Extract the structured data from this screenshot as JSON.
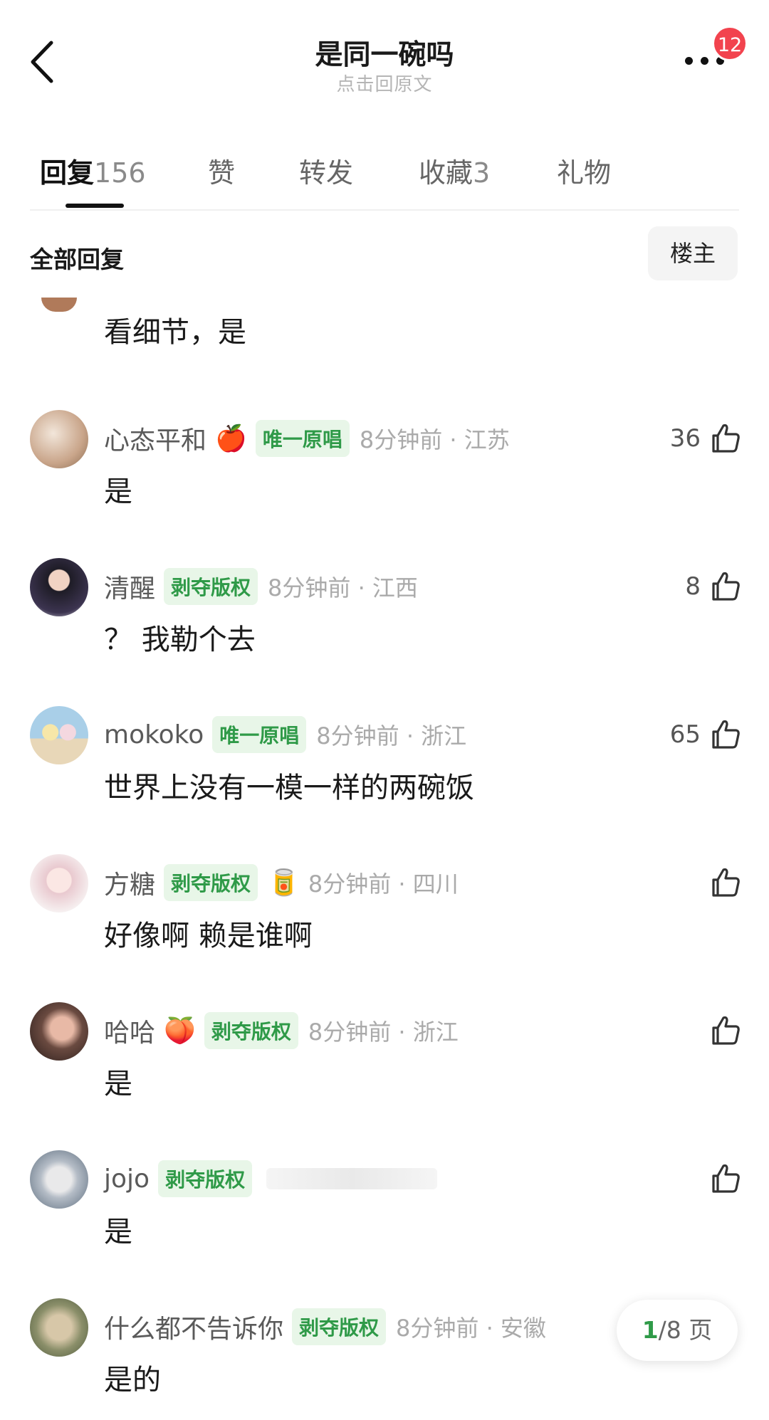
{
  "header": {
    "title": "是同一碗吗",
    "subtitle": "点击回原文",
    "badge_count": "12"
  },
  "tabs": [
    {
      "label": "回复",
      "count": "156",
      "active": true
    },
    {
      "label": "赞",
      "count": ""
    },
    {
      "label": "转发",
      "count": ""
    },
    {
      "label": "收藏",
      "count": "3"
    },
    {
      "label": "礼物",
      "count": ""
    }
  ],
  "section": {
    "title": "全部回复",
    "owner_button": "楼主"
  },
  "partial_comment": {
    "text": "看细节，是"
  },
  "comments": [
    {
      "username": "心态平和",
      "emoji": "🍎",
      "tag": "唯一原唱",
      "time": "8分钟前 · 江苏",
      "likes": "36",
      "text": "是",
      "avatar_color": "#c9a58a"
    },
    {
      "username": "清醒",
      "emoji": "",
      "tag": "剥夺版权",
      "time": "8分钟前 · 江西",
      "likes": "8",
      "text": "？ 我勒个去",
      "avatar_color": "#2b2a35"
    },
    {
      "username": "mokoko",
      "emoji": "",
      "tag": "唯一原唱",
      "time": "8分钟前 · 浙江",
      "likes": "65",
      "text": "世界上没有一模一样的两碗饭",
      "avatar_color": "#a9cfe8"
    },
    {
      "username": "方糖",
      "emoji": "",
      "tag": "剥夺版权",
      "emoji_after_tag": "🥫",
      "time": "8分钟前 · 四川",
      "likes": "",
      "text": "好像啊 赖是谁啊",
      "avatar_color": "#e9c9cf"
    },
    {
      "username": "哈哈",
      "emoji": "🍑",
      "tag": "剥夺版权",
      "time": "8分钟前 · 浙江",
      "likes": "",
      "text": "是",
      "avatar_color": "#3a2a28"
    },
    {
      "username": "jojo",
      "emoji": "",
      "tag": "剥夺版权",
      "time": "",
      "likes": "",
      "text": "是",
      "avatar_color": "#8aa0b4"
    },
    {
      "username": "什么都不告诉你",
      "emoji": "",
      "tag": "剥夺版权",
      "time": "8分钟前 · 安徽",
      "likes": "",
      "text": "是的",
      "avatar_color": "#8b8f6a"
    }
  ],
  "pagination": {
    "current": "1",
    "separator_total": "/8 页"
  },
  "colors": {
    "tag_green": "#2f9a48",
    "badge_red": "#f2434e"
  }
}
